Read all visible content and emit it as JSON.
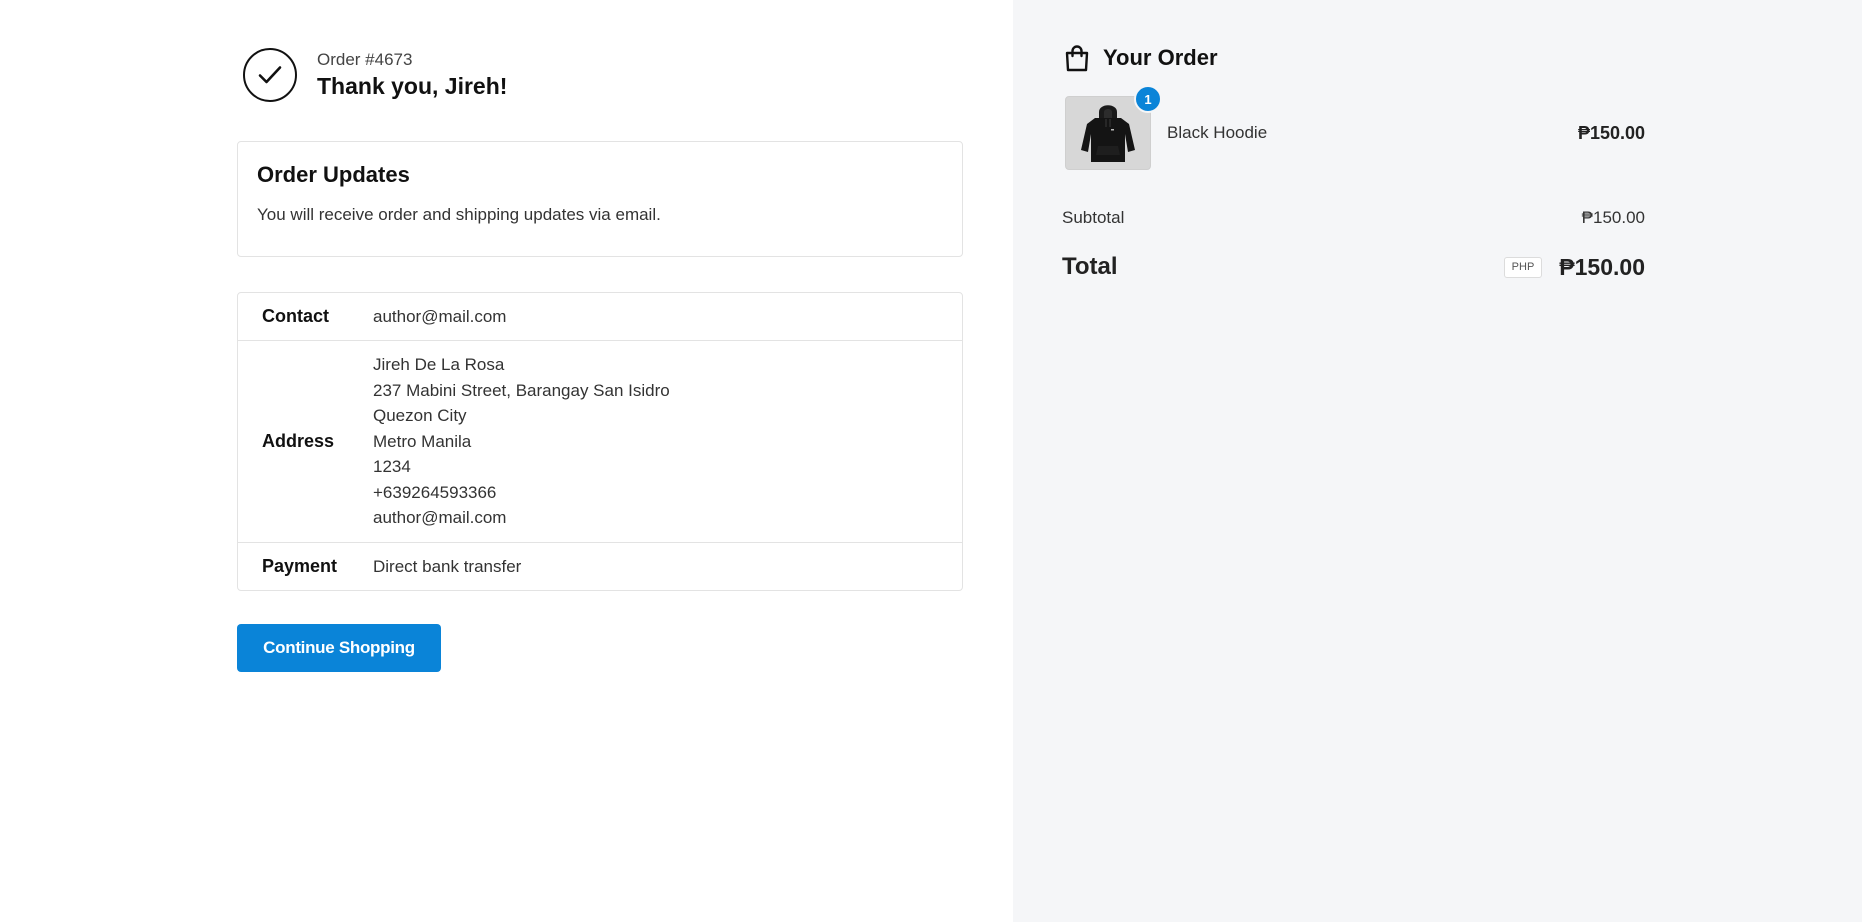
{
  "confirmation": {
    "order_number": "Order #4673",
    "thank_you": "Thank you, Jireh!",
    "check_icon": "checkmark-circle-icon"
  },
  "order_updates": {
    "title": "Order Updates",
    "message": "You will receive order and shipping updates via email."
  },
  "details": {
    "contact_label": "Contact",
    "contact_value": "author@mail.com",
    "address_label": "Address",
    "address_lines": [
      "Jireh De La Rosa",
      "237 Mabini Street, Barangay San Isidro",
      "Quezon City",
      "Metro Manila",
      "1234",
      "+639264593366",
      "author@mail.com"
    ],
    "payment_label": "Payment",
    "payment_value": "Direct bank transfer"
  },
  "actions": {
    "continue_label": "Continue Shopping"
  },
  "summary": {
    "title": "Your Order",
    "icon": "shopping-bag-icon",
    "items": [
      {
        "name": "Black Hoodie",
        "quantity": "1",
        "price": "₱150.00",
        "image": "black-hoodie-thumbnail"
      }
    ],
    "subtotal_label": "Subtotal",
    "subtotal_value": "₱150.00",
    "total_label": "Total",
    "currency": "PHP",
    "total_value": "₱150.00"
  },
  "colors": {
    "accent": "#0a84d8",
    "sidebar_bg": "#f5f6f8",
    "border": "#e3e3e3"
  }
}
